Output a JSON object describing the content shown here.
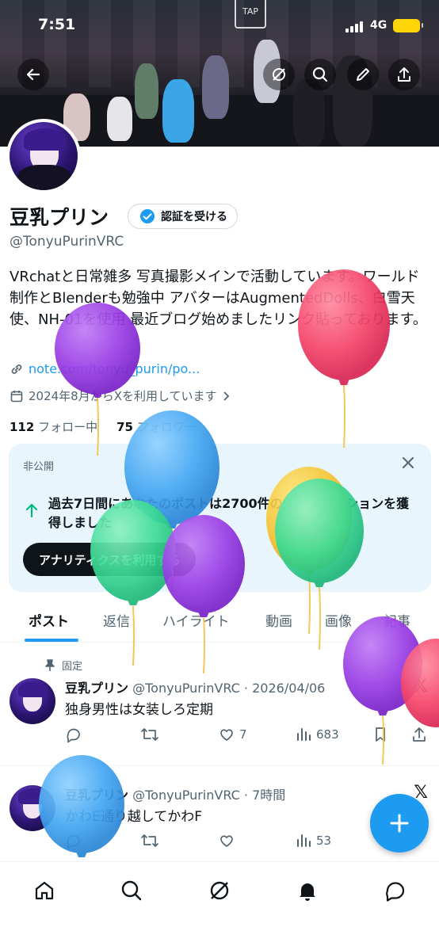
{
  "status_bar": {
    "time": "7:51",
    "network": "4G"
  },
  "header": {
    "banner_sign": "TAP"
  },
  "profile": {
    "name": "豆乳プリン",
    "verify_label": "認証を受ける",
    "handle": "@TonyuPurinVRC",
    "bio": "VRchatと日常雑多 写真撮影メインで活動しています。ワールド制作とBlenderも勉強中 アバターはAugmentedDolls、白雪天使、NH-01を使用 最近ブログ始めましたリンク貼っております。",
    "link": "note.com/tonyu_purin/po...",
    "joined": "2024年8月からXを利用しています",
    "following_count": "112",
    "following_label": "フォロー中",
    "followers_count": "75",
    "followers_label": "フォロワー"
  },
  "analytics_card": {
    "tag": "非公開",
    "message": "過去7日間にあなたのポストは2700件のインプレッションを獲得しました",
    "cta": "アナリティクスを利用する"
  },
  "tabs": [
    {
      "label": "ポスト"
    },
    {
      "label": "返信"
    },
    {
      "label": "ハイライト"
    },
    {
      "label": "動画"
    },
    {
      "label": "画像"
    },
    {
      "label": "記事"
    }
  ],
  "posts": [
    {
      "pinned_label": "固定",
      "name": "豆乳プリン",
      "handle": "@TonyuPurinVRC",
      "dot": "·",
      "time": "2026/04/06",
      "text": "独身男性は女装しろ定期",
      "likes": "7",
      "views": "683"
    },
    {
      "name": "豆乳プリン",
      "handle": "@TonyuPurinVRC",
      "dot": "·",
      "time": "7時間",
      "text": "かわE通り越してかわF",
      "views": "53"
    }
  ],
  "colors": {
    "accent": "#1d9bf0",
    "text": "#0f1419",
    "muted": "#536471",
    "card_bg": "#e8f5fd"
  }
}
